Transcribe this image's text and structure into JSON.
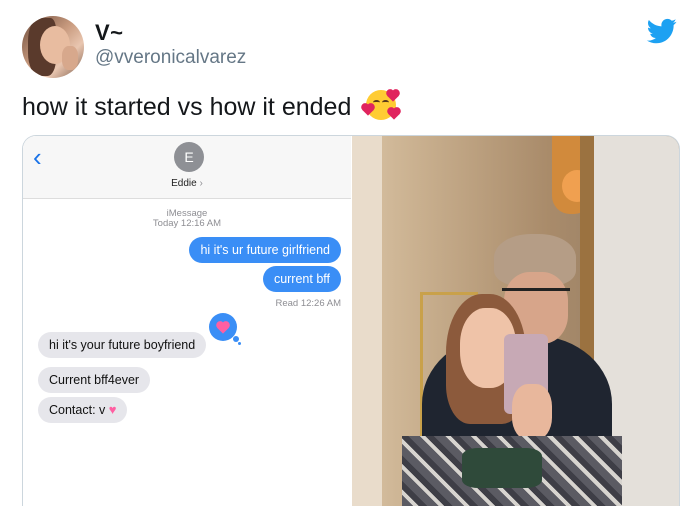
{
  "tweet": {
    "display_name": "V~",
    "handle": "@vveronicalvarez",
    "text": "how it started vs how it ended",
    "emoji": "smiling-face-with-hearts"
  },
  "chat": {
    "contact_initial": "E",
    "contact_name": "Eddie",
    "header_lines": [
      "iMessage",
      "Today 12:16 AM"
    ],
    "read_receipt": "Read 12:26 AM",
    "sent_messages": [
      "hi it's ur future girlfriend",
      "current bff"
    ],
    "received_messages": [
      "hi it's your future boyfriend",
      "Current bff4ever",
      "Contact: v"
    ],
    "colors": {
      "sent": "#3a8ef6",
      "received": "#e6e6eb"
    }
  },
  "photo": {
    "description_icon": "mirror-selfie-photo"
  },
  "icons": {
    "brand": "twitter-bird-icon",
    "back": "chevron-left-icon"
  }
}
